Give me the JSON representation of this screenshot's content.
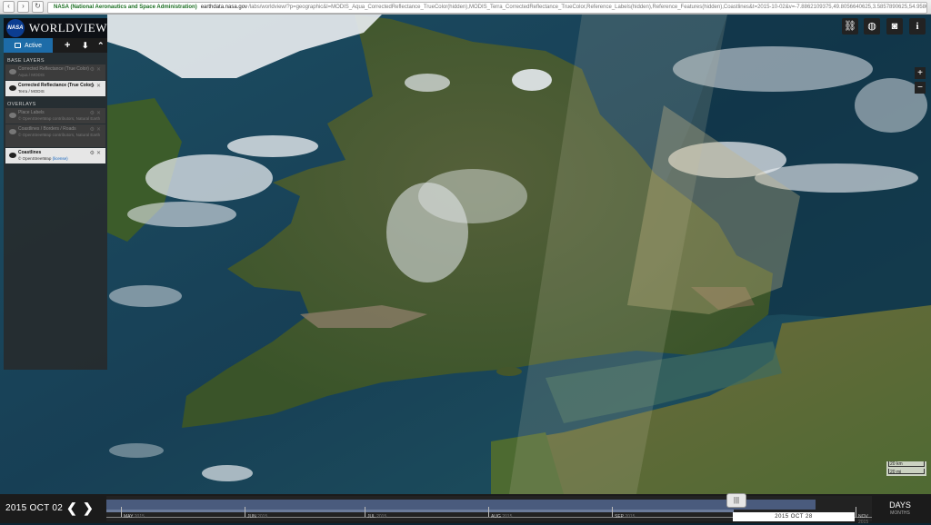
{
  "browser": {
    "back_icon": "back-arrow-icon",
    "forward_icon": "forward-arrow-icon",
    "org_label": "NASA (National Aeronautics and Space Administration)",
    "url_host": "earthdata.nasa.gov",
    "url_path": "/labs/worldview/?p=geographic&l=MODIS_Aqua_CorrectedReflectance_TrueColor(hidden),MODIS_Terra_CorrectedReflectance_TrueColor,Reference_Labels(hidden),Reference_Features(hidden),Coastlines&t=2015-10-02&v=-7.8862109375,49.8056640625,3.5857890625,54.9580078125 · EOSDIS Worldview"
  },
  "app": {
    "logo_text": "NASA",
    "title": "WORLDVIEW"
  },
  "panel": {
    "tab_active": "Active",
    "add_icon": "plus-icon",
    "download_icon": "download-icon",
    "collapse_icon": "collapse-chevron-icon",
    "base_layers_header": "BASE LAYERS",
    "overlays_header": "OVERLAYS",
    "base_layers": [
      {
        "name": "Corrected Reflectance (True Color)",
        "source": "Aqua / MODIS",
        "visible": false
      },
      {
        "name": "Corrected Reflectance (True Color)",
        "source": "Terra / MODIS",
        "visible": true
      }
    ],
    "overlays": [
      {
        "name": "Place Labels",
        "source": "© OpenStreetMap contributors, Natural Earth",
        "visible": false
      },
      {
        "name": "Coastlines / Borders / Roads",
        "source": "© OpenStreetMap contributors, Natural Earth",
        "visible": false
      },
      {
        "name": "Coastlines",
        "source": "© OpenStreetMap",
        "source_link": "(license)",
        "visible": true
      }
    ]
  },
  "toolbar": {
    "link_icon": "link-icon",
    "projection_icon": "globe-icon",
    "camera_icon": "camera-icon",
    "info_icon": "info-icon",
    "zoom_in": "+",
    "zoom_out": "−"
  },
  "scale": {
    "km": "20 km",
    "mi": "20 mi"
  },
  "timeline": {
    "current_date": "2015 OCT 02",
    "prev_icon": "chevron-left-icon",
    "next_icon": "chevron-right-icon",
    "months": [
      {
        "label": "MAY",
        "year": "2015"
      },
      {
        "label": "JUN",
        "year": "2015"
      },
      {
        "label": "JUL",
        "year": "2015"
      },
      {
        "label": "AUG",
        "year": "2015"
      },
      {
        "label": "SEP",
        "year": "2015"
      },
      {
        "label": "NOV",
        "year": "2015"
      }
    ],
    "selected_range_end": "2015 OCT 28",
    "handle_icon": "drag-handle-icon",
    "zoom_unit": "DAYS",
    "zoom_unit_alt": "MONTHS"
  },
  "colors": {
    "accent": "#1d6ca8",
    "sea": "#16405a",
    "land": "#3f5a2b",
    "cloud": "#e4e8ec"
  }
}
